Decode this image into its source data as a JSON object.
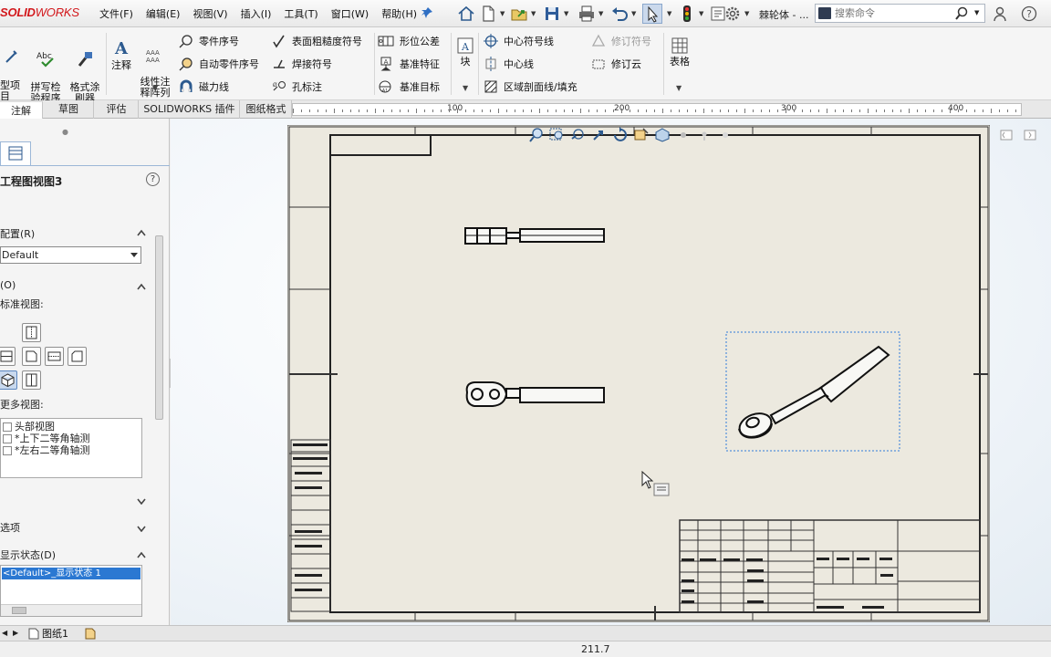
{
  "app": {
    "logo_prefix": "SOLID",
    "logo_suffix": "WORKS",
    "document_name": "棘轮体 - ..."
  },
  "menu": [
    "文件(F)",
    "编辑(E)",
    "视图(V)",
    "插入(I)",
    "工具(T)",
    "窗口(W)",
    "帮助(H)"
  ],
  "search": {
    "placeholder": "搜索命令"
  },
  "ribbon": {
    "model_items": "型项\n目",
    "spell_check": "拼写检\n验程序",
    "format_painter": "格式涂\n刷器",
    "note": "注释",
    "linear_note": "线性注\n释阵列",
    "balloon": "零件序号",
    "auto_balloon": "自动零件序号",
    "magnetic_line": "磁力线",
    "surface_finish": "表面粗糙度符号",
    "weld_symbol": "焊接符号",
    "hole_callout": "孔标注",
    "geometric_tolerance": "形位公差",
    "datum_feature": "基准特征",
    "datum_target": "基准目标",
    "block": "块",
    "center_mark": "中心符号线",
    "centerline": "中心线",
    "area_hatch": "区域剖面线/填充",
    "revision_symbol": "修订符号",
    "revision_cloud": "修订云",
    "table": "表格"
  },
  "command_tabs": [
    "注解",
    "草图",
    "评估",
    "SOLIDWORKS 插件",
    "图纸格式"
  ],
  "ruler": {
    "labels": [
      "100",
      "200",
      "300",
      "400"
    ]
  },
  "panel": {
    "title": "工程图视图3",
    "help_glyph": "?",
    "config_section": "配置(R)",
    "config_value": "Default",
    "orientation_section": "(O)",
    "standard_views": "标准视图:",
    "more_views": "更多视图:",
    "more_views_items": [
      "头部视图",
      "*上下二等角轴测",
      "*左右二等角轴测"
    ],
    "options_section": "选项",
    "display_section": "显示状态(D)",
    "display_state_row": "<Default>_显示状态 1"
  },
  "sheet_tabs": [
    "图纸1"
  ],
  "status": {
    "coordinate": "211.7"
  },
  "colors": {
    "sheet_bg": "#ece9df",
    "selection": "#2b78d2",
    "logo_red": "#d2171b"
  },
  "icons": [
    "home-icon",
    "new-icon",
    "open-icon",
    "save-icon",
    "print-icon",
    "undo-icon",
    "select-icon",
    "traffic-light-icon",
    "options-icon",
    "search-icon",
    "user-icon",
    "help-icon"
  ]
}
